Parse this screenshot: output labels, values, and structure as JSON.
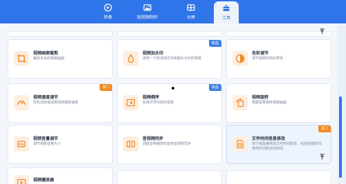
{
  "nav": {
    "tabs": [
      {
        "label": "转换",
        "icon": "convert-icon",
        "active": false
      },
      {
        "label": "短视频制作",
        "icon": "image-icon",
        "active": false
      },
      {
        "label": "分屏",
        "icon": "split-screen-icon",
        "active": false
      },
      {
        "label": "工具",
        "icon": "toolbox-icon",
        "active": true
      }
    ]
  },
  "colors": {
    "brand": "#2f74e8",
    "accent_orange": "#f28a1f",
    "badge_blue": "#3e7fe8",
    "icon_orange": "#f08a2b"
  },
  "cards": [
    {
      "title": "视频画面裁剪",
      "desc": "裁剪多余的视频画面",
      "icon": "crop-icon",
      "badge": ""
    },
    {
      "title": "视频加水印",
      "desc": "选择一个愿添加文字和图片水印的视频",
      "icon": "droplet-icon",
      "badge": "新品"
    },
    {
      "title": "色彩调节",
      "desc": "调节视频的色彩表现",
      "icon": "palette-icon",
      "badge": ""
    },
    {
      "title": "视频速度调节",
      "desc": "轻松加快或减慢视频播放速度",
      "icon": "speedometer-icon",
      "badge": "热门"
    },
    {
      "title": "视频倒序",
      "desc": "反转并导出逆向视频",
      "icon": "rewind-icon",
      "badge": "新品"
    },
    {
      "title": "视频旋转",
      "desc": "根据需要旋转视频画面",
      "icon": "rotate-icon",
      "badge": ""
    },
    {
      "title": "视频音量调节",
      "desc": "调节视频音量大小",
      "icon": "volume-icon",
      "badge": ""
    },
    {
      "title": "音视频同步",
      "desc": "调整音频播放时延使音视频同步",
      "icon": "sync-icon",
      "badge": ""
    },
    {
      "title": "文件时间信息修改",
      "desc": "单个或批量修改文件时间属性，包括创建时间、修改时间和访问时间",
      "icon": "file-time-icon",
      "badge": "热门"
    },
    {
      "title": "视频播放器",
      "desc": "",
      "icon": "play-icon",
      "badge": ""
    }
  ]
}
